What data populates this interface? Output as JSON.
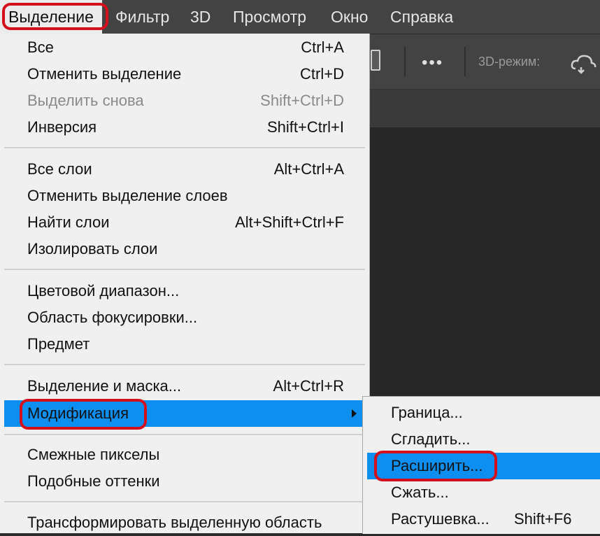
{
  "menubar": {
    "items": [
      "Выделение",
      "Фильтр",
      "3D",
      "Просмотр",
      "Окно",
      "Справка"
    ]
  },
  "options_bar": {
    "more": "•••",
    "mode_label": "3D-режим:"
  },
  "dropdown": {
    "groups": [
      [
        {
          "label": "Все",
          "shortcut": "Ctrl+A",
          "disabled": false
        },
        {
          "label": "Отменить выделение",
          "shortcut": "Ctrl+D",
          "disabled": false
        },
        {
          "label": "Выделить снова",
          "shortcut": "Shift+Ctrl+D",
          "disabled": true
        },
        {
          "label": "Инверсия",
          "shortcut": "Shift+Ctrl+I",
          "disabled": false
        }
      ],
      [
        {
          "label": "Все слои",
          "shortcut": "Alt+Ctrl+A",
          "disabled": false
        },
        {
          "label": "Отменить выделение слоев",
          "shortcut": "",
          "disabled": false
        },
        {
          "label": "Найти слои",
          "shortcut": "Alt+Shift+Ctrl+F",
          "disabled": false
        },
        {
          "label": "Изолировать слои",
          "shortcut": "",
          "disabled": false
        }
      ],
      [
        {
          "label": "Цветовой диапазон...",
          "shortcut": "",
          "disabled": false
        },
        {
          "label": "Область фокусировки...",
          "shortcut": "",
          "disabled": false
        },
        {
          "label": "Предмет",
          "shortcut": "",
          "disabled": false
        }
      ],
      [
        {
          "label": "Выделение и маска...",
          "shortcut": "Alt+Ctrl+R",
          "disabled": false
        },
        {
          "label": "Модификация",
          "shortcut": "",
          "disabled": false,
          "highlighted": true,
          "submenu": true
        }
      ],
      [
        {
          "label": "Смежные пикселы",
          "shortcut": "",
          "disabled": false
        },
        {
          "label": "Подобные оттенки",
          "shortcut": "",
          "disabled": false
        }
      ],
      [
        {
          "label": "Трансформировать выделенную область",
          "shortcut": "",
          "disabled": false
        }
      ]
    ]
  },
  "submenu": {
    "items": [
      {
        "label": "Граница...",
        "shortcut": ""
      },
      {
        "label": "Сгладить...",
        "shortcut": ""
      },
      {
        "label": "Расширить...",
        "shortcut": "",
        "highlighted": true
      },
      {
        "label": "Сжать...",
        "shortcut": ""
      },
      {
        "label": "Растушевка...",
        "shortcut": "Shift+F6"
      }
    ]
  },
  "colors": {
    "highlight": "#0c8ff0",
    "annotation_ring": "#d3101c",
    "menu_bg": "#f0f0f0",
    "app_bg": "#434343"
  }
}
